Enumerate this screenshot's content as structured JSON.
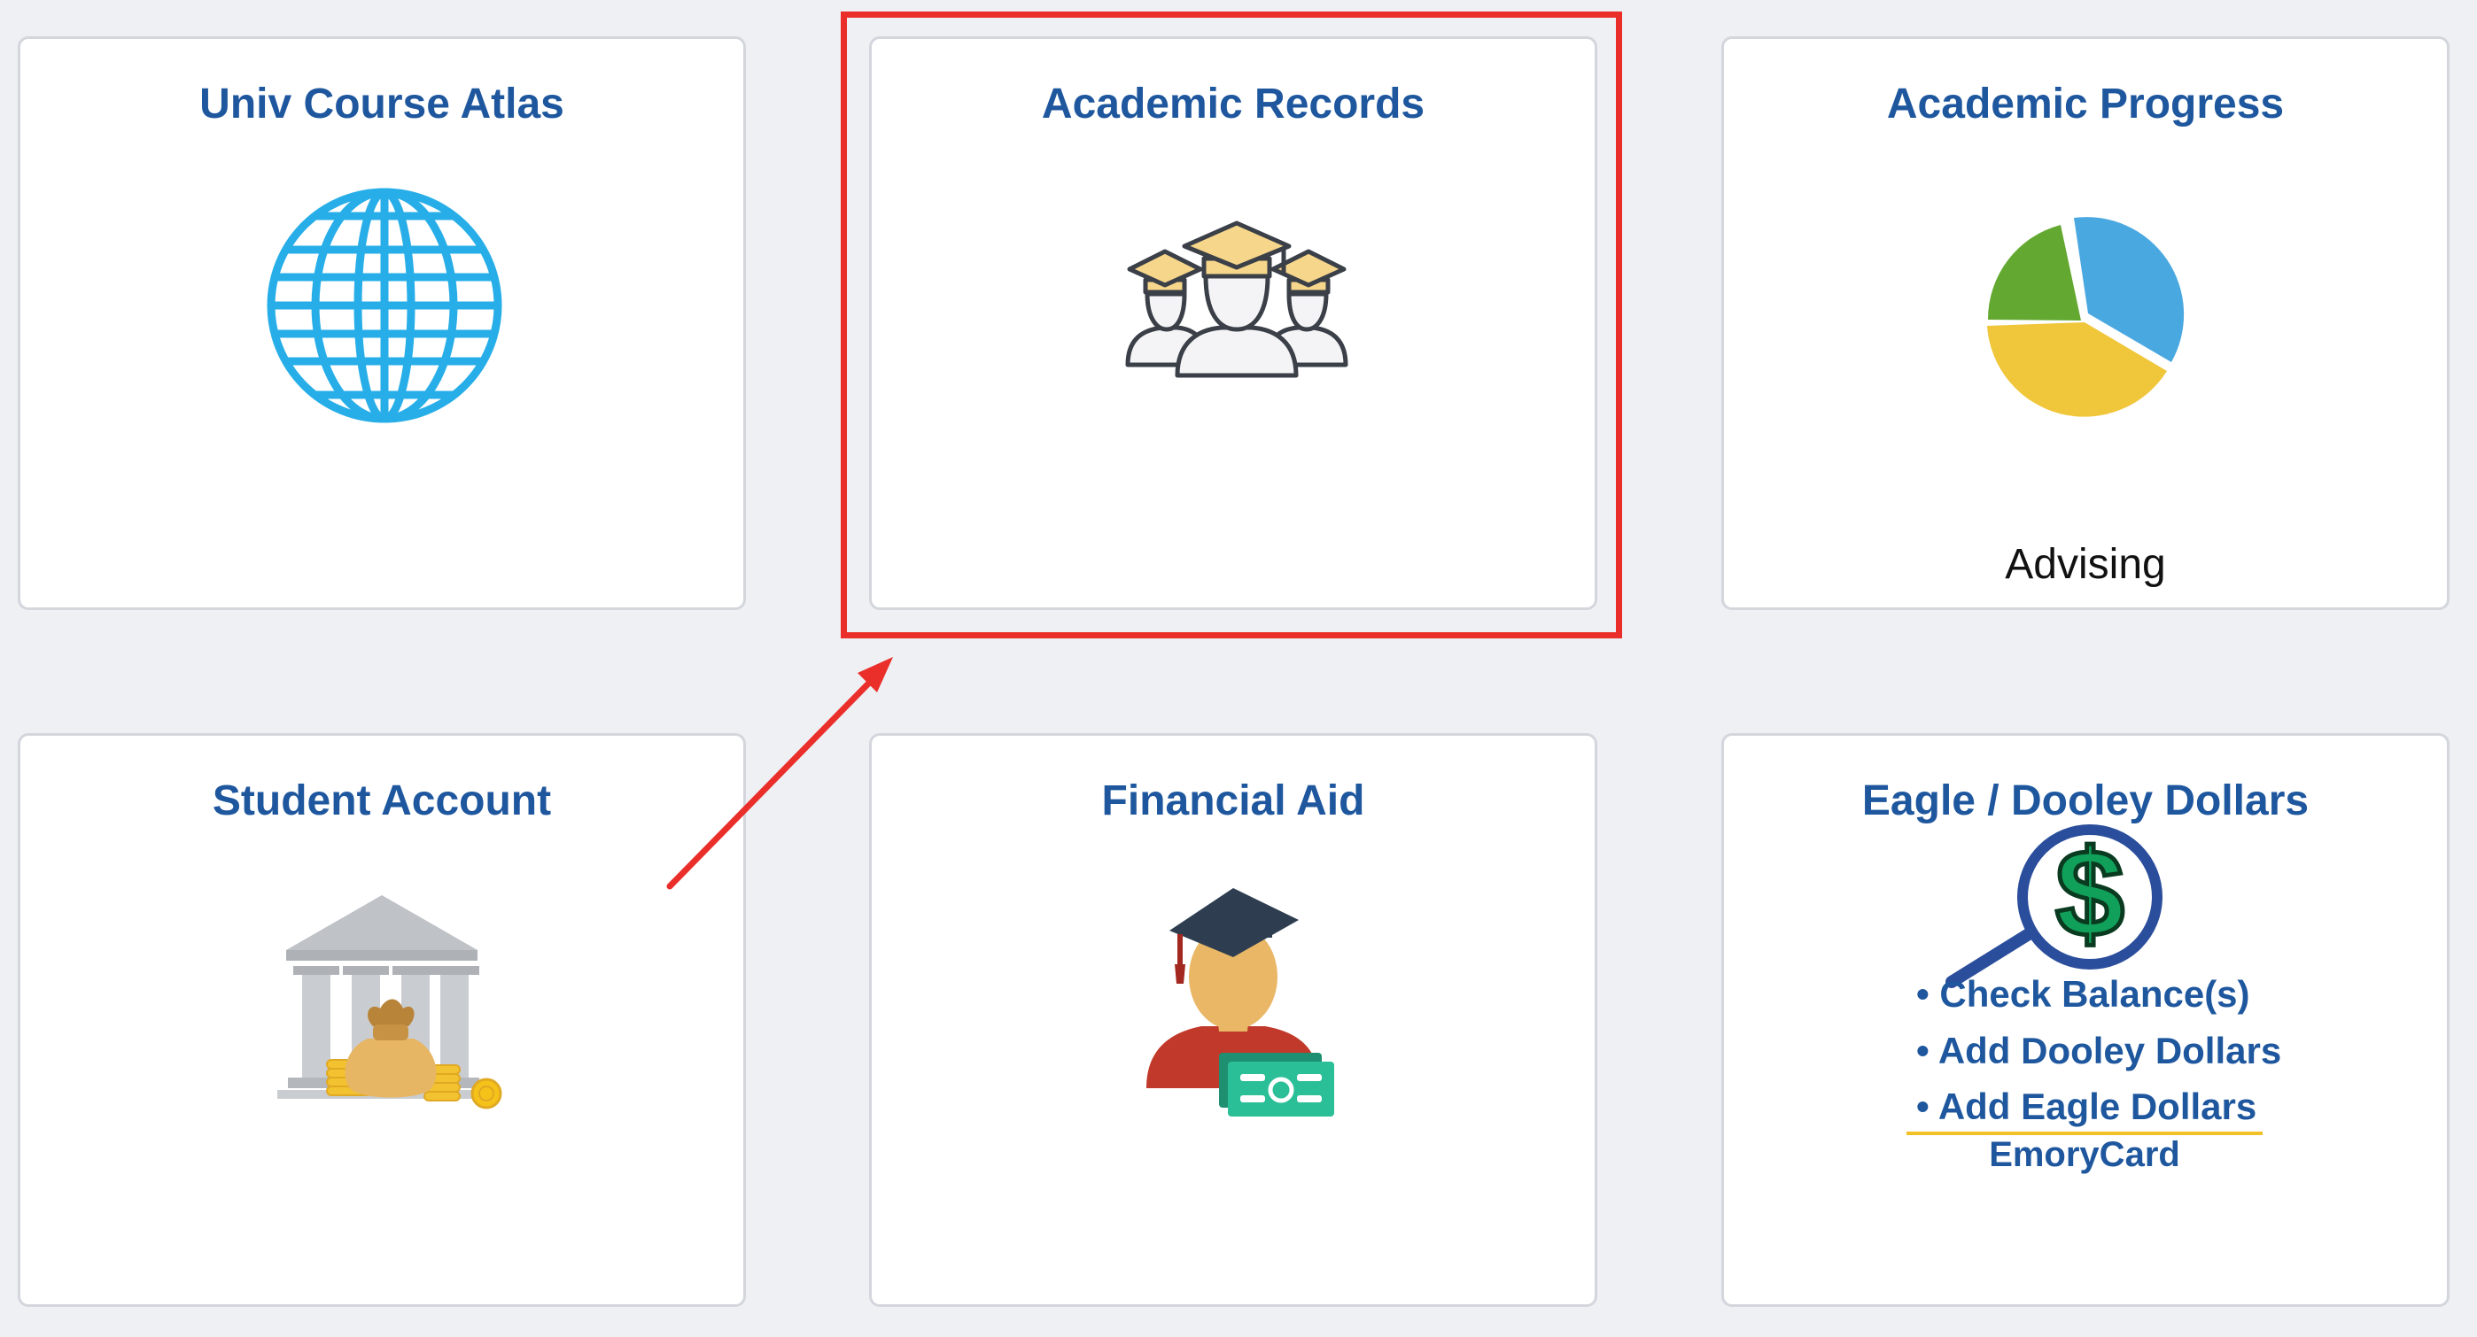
{
  "tiles": {
    "course_atlas": {
      "title": "Univ Course Atlas",
      "icon": "globe-icon"
    },
    "academic_records": {
      "title": "Academic Records",
      "icon": "graduates-icon"
    },
    "academic_progress": {
      "title": "Academic Progress",
      "subtitle": "Advising",
      "icon": "pie-chart-icon"
    },
    "student_account": {
      "title": "Student Account",
      "icon": "bank-money-icon"
    },
    "financial_aid": {
      "title": "Financial Aid",
      "icon": "graduate-money-icon"
    },
    "eagle_dooley": {
      "title": "Eagle / Dooley Dollars",
      "icon": "dollar-magnifier-icon",
      "links": [
        "• Check Balance(s)",
        "• Add Dooley Dollars",
        "• Add Eagle Dollars"
      ],
      "footer": "EmoryCard"
    }
  },
  "annotation": {
    "highlight_color": "#ea2f2b",
    "highlighted_tile": "Academic Records"
  },
  "colors": {
    "background": "#eff0f4",
    "title": "#1e579e",
    "globe": "#27aee8",
    "accent_gold": "#f2c027"
  }
}
